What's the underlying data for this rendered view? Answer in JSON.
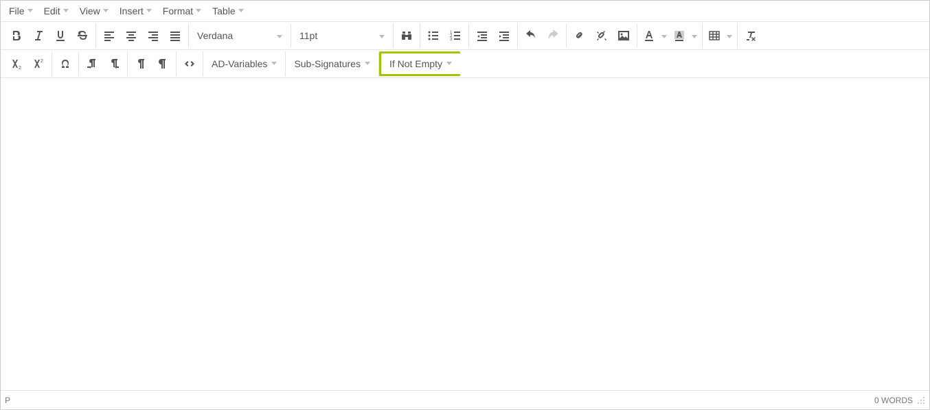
{
  "menubar": {
    "file": "File",
    "edit": "Edit",
    "view": "View",
    "insert": "Insert",
    "format": "Format",
    "table": "Table"
  },
  "toolbar": {
    "font_family": "Verdana",
    "font_size": "11pt",
    "ad_variables": "AD-Variables",
    "sub_signatures": "Sub-Signatures",
    "if_not_empty": "If Not Empty"
  },
  "statusbar": {
    "path": "P",
    "words": "0 WORDS"
  }
}
